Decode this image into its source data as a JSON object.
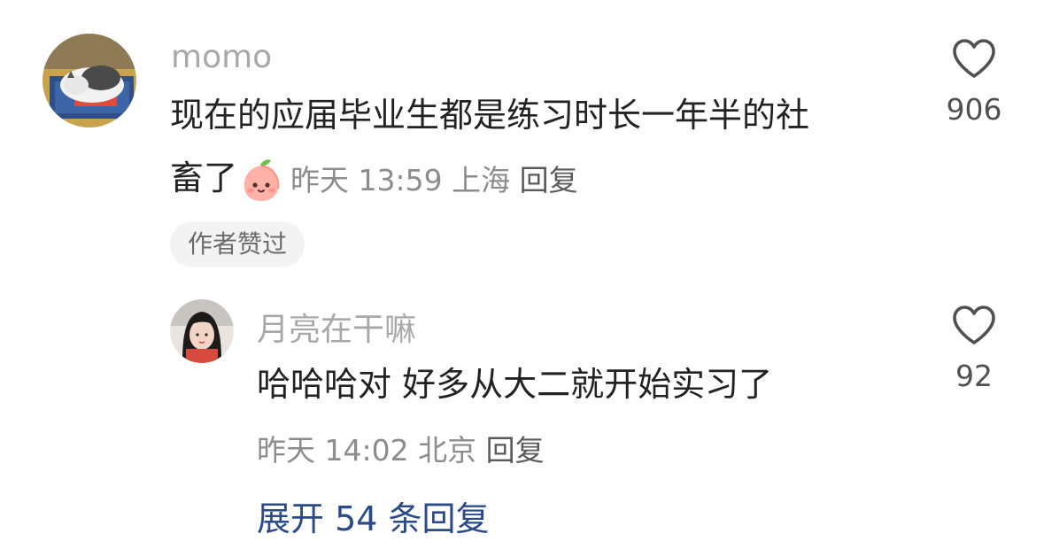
{
  "comment": {
    "username": "momo",
    "text_line1": "现在的应届毕业生都是练习时长一年半的社",
    "text_line2": "畜了",
    "emoji_icon": "peach-face-emoji",
    "time": "昨天 13:59",
    "location": "上海",
    "reply_label": "回复",
    "like_count": "906",
    "badge": "作者赞过"
  },
  "reply": {
    "username": "月亮在干嘛",
    "text": "哈哈哈对 好多从大二就开始实习了",
    "time": "昨天 14:02",
    "location": "北京",
    "reply_label": "回复",
    "like_count": "92"
  },
  "expand": {
    "label": "展开 54 条回复"
  },
  "colors": {
    "link": "#2b4a8a",
    "username": "#a8a8a8",
    "text": "#222222",
    "meta": "#8c8c8c"
  }
}
